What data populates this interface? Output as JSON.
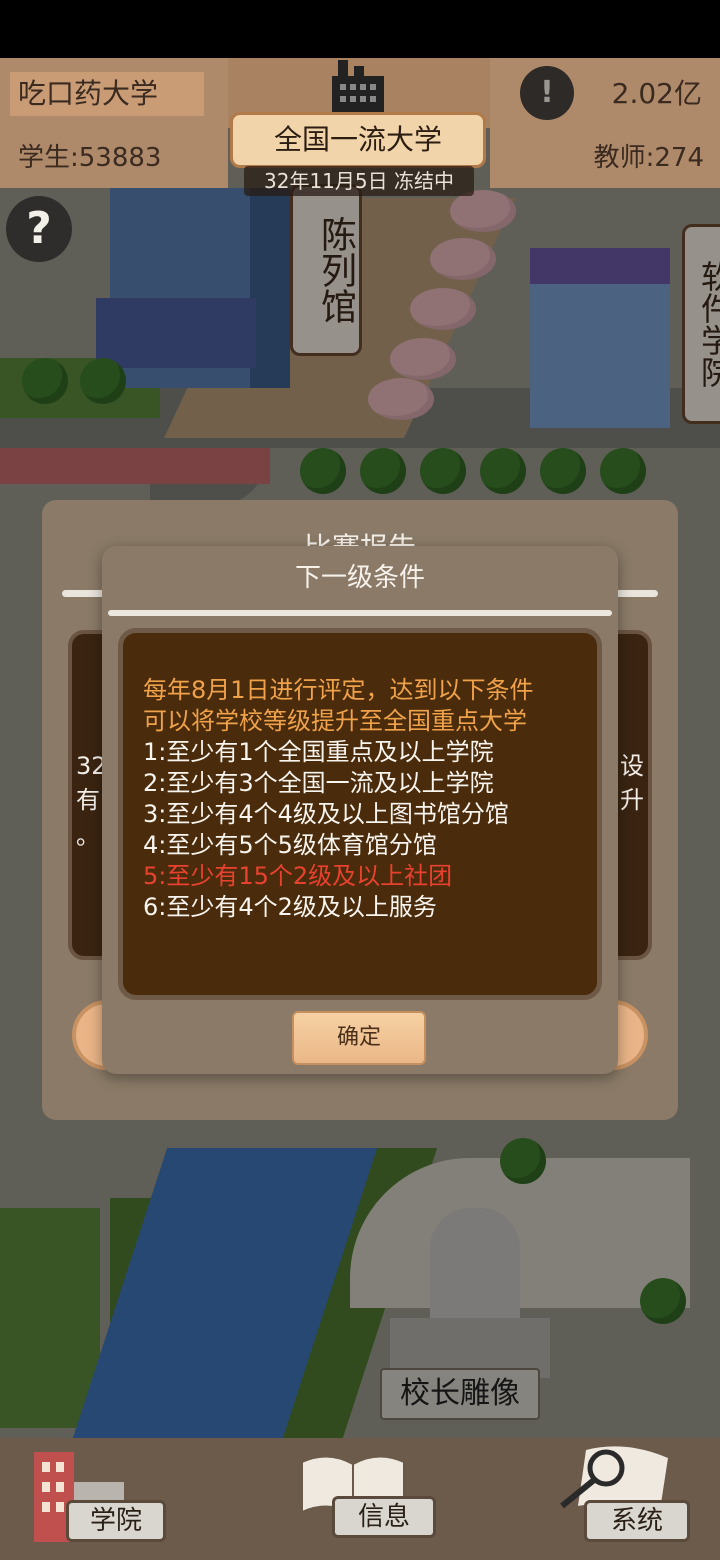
{
  "hud": {
    "university_name": "吃口药大学",
    "students": "学生:53883",
    "teachers": "教师:274",
    "money": "2.02亿",
    "rank": "全国一流大学",
    "date_status": "32年11月5日 冻结中",
    "alert_symbol": "!",
    "help_symbol": "?"
  },
  "map": {
    "sign_exhibition": "陈列馆",
    "sign_software": "软件学院",
    "statue_plaque": "校长雕像"
  },
  "report_dialog": {
    "title": "比赛报告",
    "text_left_1": "32",
    "text_left_2": "有",
    "text_left_3": "。",
    "text_right_1": "设",
    "text_right_2": "升"
  },
  "condition_dialog": {
    "title": "下一级条件",
    "intro_line_1": "每年8月1日进行评定，达到以下条件",
    "intro_line_2": "可以将学校等级提升至全国重点大学",
    "conditions": [
      "1:至少有1个全国重点及以上学院",
      "2:至少有3个全国一流及以上学院",
      "3:至少有4个4级及以上图书馆分馆",
      "4:至少有5个5级体育馆分馆",
      "5:至少有15个2级及以上社团",
      "6:至少有4个2级及以上服务"
    ],
    "unmet_condition_color": "#e8412f",
    "ok_label": "确定"
  },
  "nav": {
    "college": "学院",
    "info": "信息",
    "system": "系统"
  },
  "icons": {
    "alert": "exclamation-icon",
    "help": "question-icon",
    "rank": "factory-icon",
    "college": "building-icon",
    "info": "book-icon",
    "system": "magnifier-icon"
  }
}
